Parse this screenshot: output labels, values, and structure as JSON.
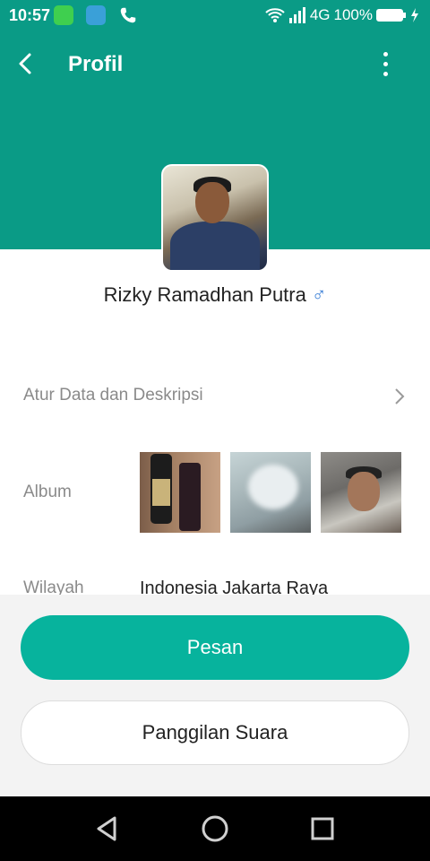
{
  "status_bar": {
    "time": "10:57",
    "network": "4G",
    "battery": "100%"
  },
  "header": {
    "title": "Profil"
  },
  "profile": {
    "name": "Rizky Ramadhan Putra",
    "gender_symbol": "♂"
  },
  "rows": {
    "edit_label": "Atur Data dan Deskripsi",
    "album_label": "Album",
    "region_label": "Wilayah",
    "region_value": "Indonesia Jakarta Raya"
  },
  "actions": {
    "message": "Pesan",
    "voice_call": "Panggilan Suara"
  },
  "colors": {
    "primary": "#07b39d",
    "header_bg": "#0a9b86"
  }
}
